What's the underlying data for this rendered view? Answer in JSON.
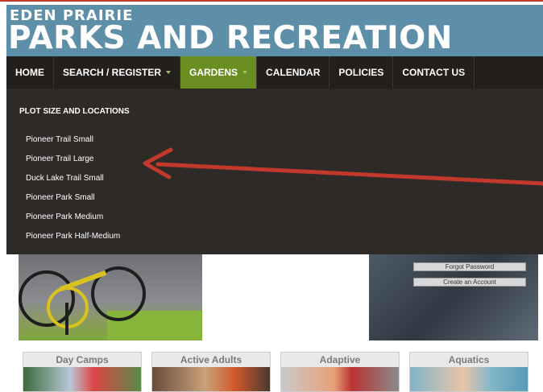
{
  "header": {
    "logo_line1": "EDEN PRAIRIE",
    "logo_line2": "PARKS AND RECREATION"
  },
  "nav": {
    "items": [
      {
        "label": "HOME",
        "active": false,
        "has_dropdown": false
      },
      {
        "label": "SEARCH / REGISTER",
        "active": false,
        "has_dropdown": true
      },
      {
        "label": "GARDENS",
        "active": true,
        "has_dropdown": true
      },
      {
        "label": "CALENDAR",
        "active": false,
        "has_dropdown": false
      },
      {
        "label": "POLICIES",
        "active": false,
        "has_dropdown": false
      },
      {
        "label": "CONTACT US",
        "active": false,
        "has_dropdown": false
      }
    ]
  },
  "dropdown": {
    "heading": "PLOT SIZE AND LOCATIONS",
    "items": [
      "Pioneer Trail Small",
      "Pioneer Trail Large",
      "Duck Lake Trail Small",
      "Pioneer Park Small",
      "Pioneer Park Medium",
      "Pioneer Park Half-Medium"
    ]
  },
  "login": {
    "forgot_password": "Forgot Password",
    "create_account": "Create an Account"
  },
  "program_tiles": [
    {
      "label": "Day Camps"
    },
    {
      "label": "Active Adults"
    },
    {
      "label": "Adaptive"
    },
    {
      "label": "Aquatics"
    }
  ],
  "colors": {
    "header_bg": "#5e8fa8",
    "nav_bg": "#231f1c",
    "nav_active": "#6b8e23",
    "dropdown_bg": "#2e2a28",
    "annotation_arrow": "#c0392b"
  },
  "icons": {
    "annotation": "red-arrow-pointing-left",
    "dropdown_indicator": "caret-down-icon"
  }
}
